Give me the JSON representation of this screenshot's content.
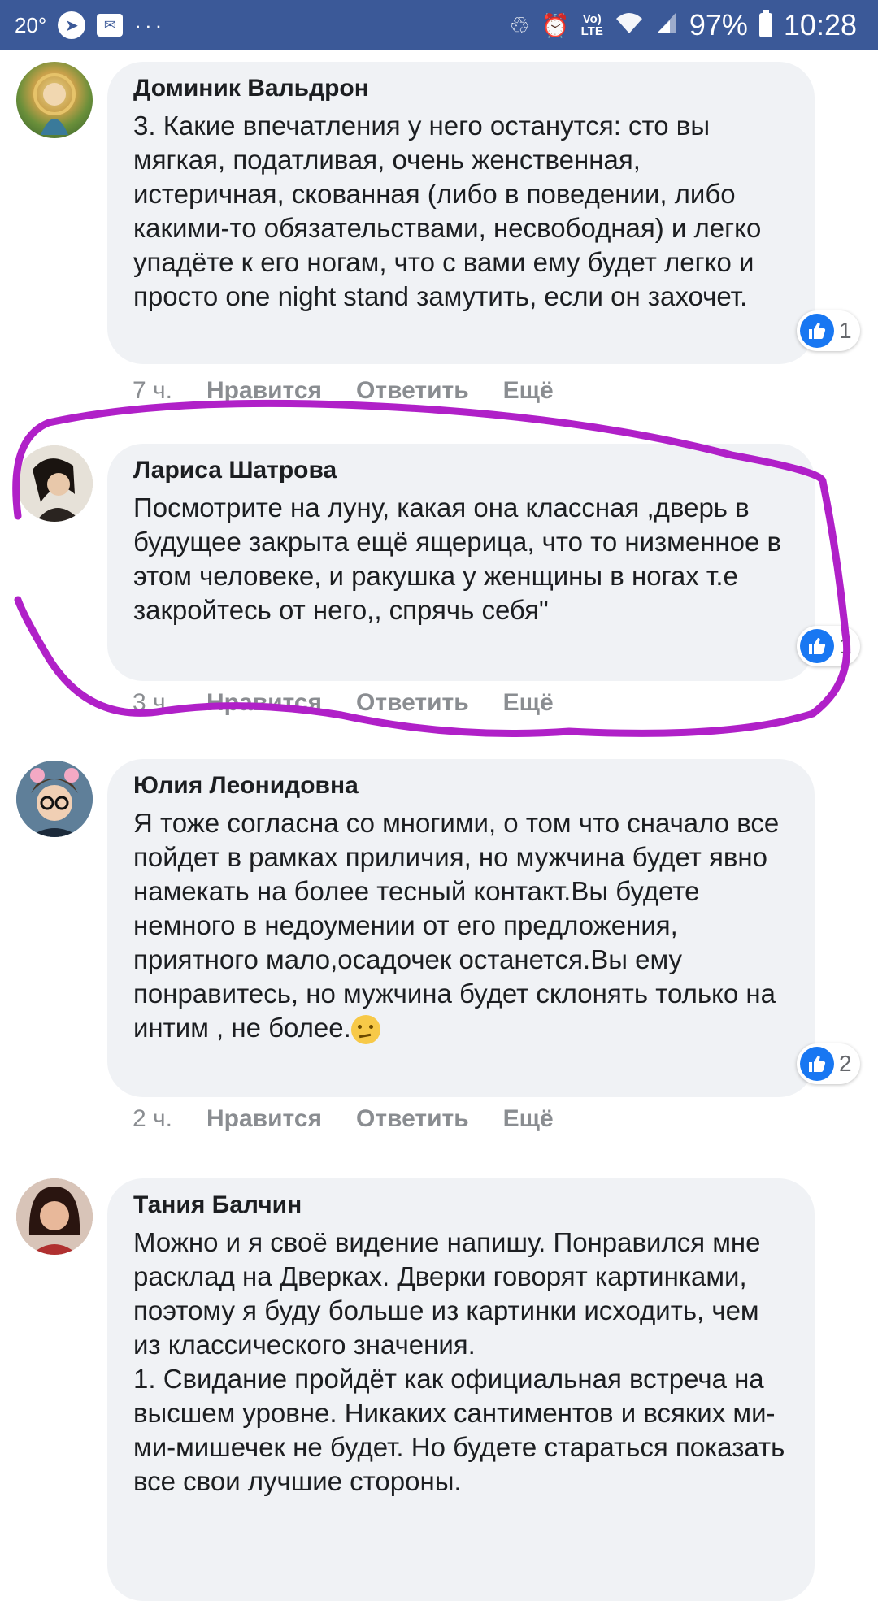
{
  "status_bar": {
    "temperature": "20°",
    "dots": "···",
    "battery_percent": "97%",
    "time": "10:28",
    "network_lte": "Vo) LTE",
    "icons": [
      "telegram-icon",
      "message-icon",
      "recycle-icon",
      "alarm-icon",
      "wifi-icon",
      "signal-icon",
      "battery-icon"
    ]
  },
  "comments": [
    {
      "author": "Доминик Вальдрон",
      "text": "3. Какие впечатления у него останутся: сто вы мягкая, податливая, очень женственная, истеричная, скованная (либо в поведении, либо какими-то обязательствами, несвободная) и легко упадёте к его ногам, что с вами ему будет легко и просто one night stand замутить, если он захочет.",
      "time": "7 ч.",
      "like_label": "Нравится",
      "reply_label": "Ответить",
      "more_label": "Ещё",
      "reactions": "1"
    },
    {
      "author": "Лариса Шатрова",
      "text": "Посмотрите на луну, какая она классная ,дверь в будущее закрыта ещё ящерица, что то низменное в этом человеке, и ракушка у женщины в ногах т.е закройтесь от него,, спрячь себя\"",
      "time": "3 ч.",
      "like_label": "Нравится",
      "reply_label": "Ответить",
      "more_label": "Ещё",
      "reactions": "1"
    },
    {
      "author": "Юлия Леонидовна",
      "text": "Я тоже согласна со многими, о том что сначало все пойдет в рамках приличия, но мужчина будет явно намекать на более тесный контакт.Вы будете немного в недоумении от его предложения, приятного мало,осадочек останется.Вы ему понравитесь, но мужчина будет склонять только на интим , не более.",
      "time": "2 ч.",
      "like_label": "Нравится",
      "reply_label": "Ответить",
      "more_label": "Ещё",
      "reactions": "2"
    },
    {
      "author": "Тания Балчин",
      "text": "Можно и я своё видение напишу. Понравился мне расклад на Дверках. Дверки говорят картинками, поэтому я буду больше из картинки исходить, чем из классического значения.\n1. Свидание пройдёт как официальная встреча на высшем уровне. Никаких сантиментов и всяких ми-ми-мишечек не будет. Но будете стараться показать все свои лучшие стороны."
    }
  ],
  "colors": {
    "status_bar_bg": "#3b5998",
    "bubble_bg": "#f0f2f5",
    "annotation_stroke": "#b020c8",
    "like_blue": "#1877f2"
  }
}
